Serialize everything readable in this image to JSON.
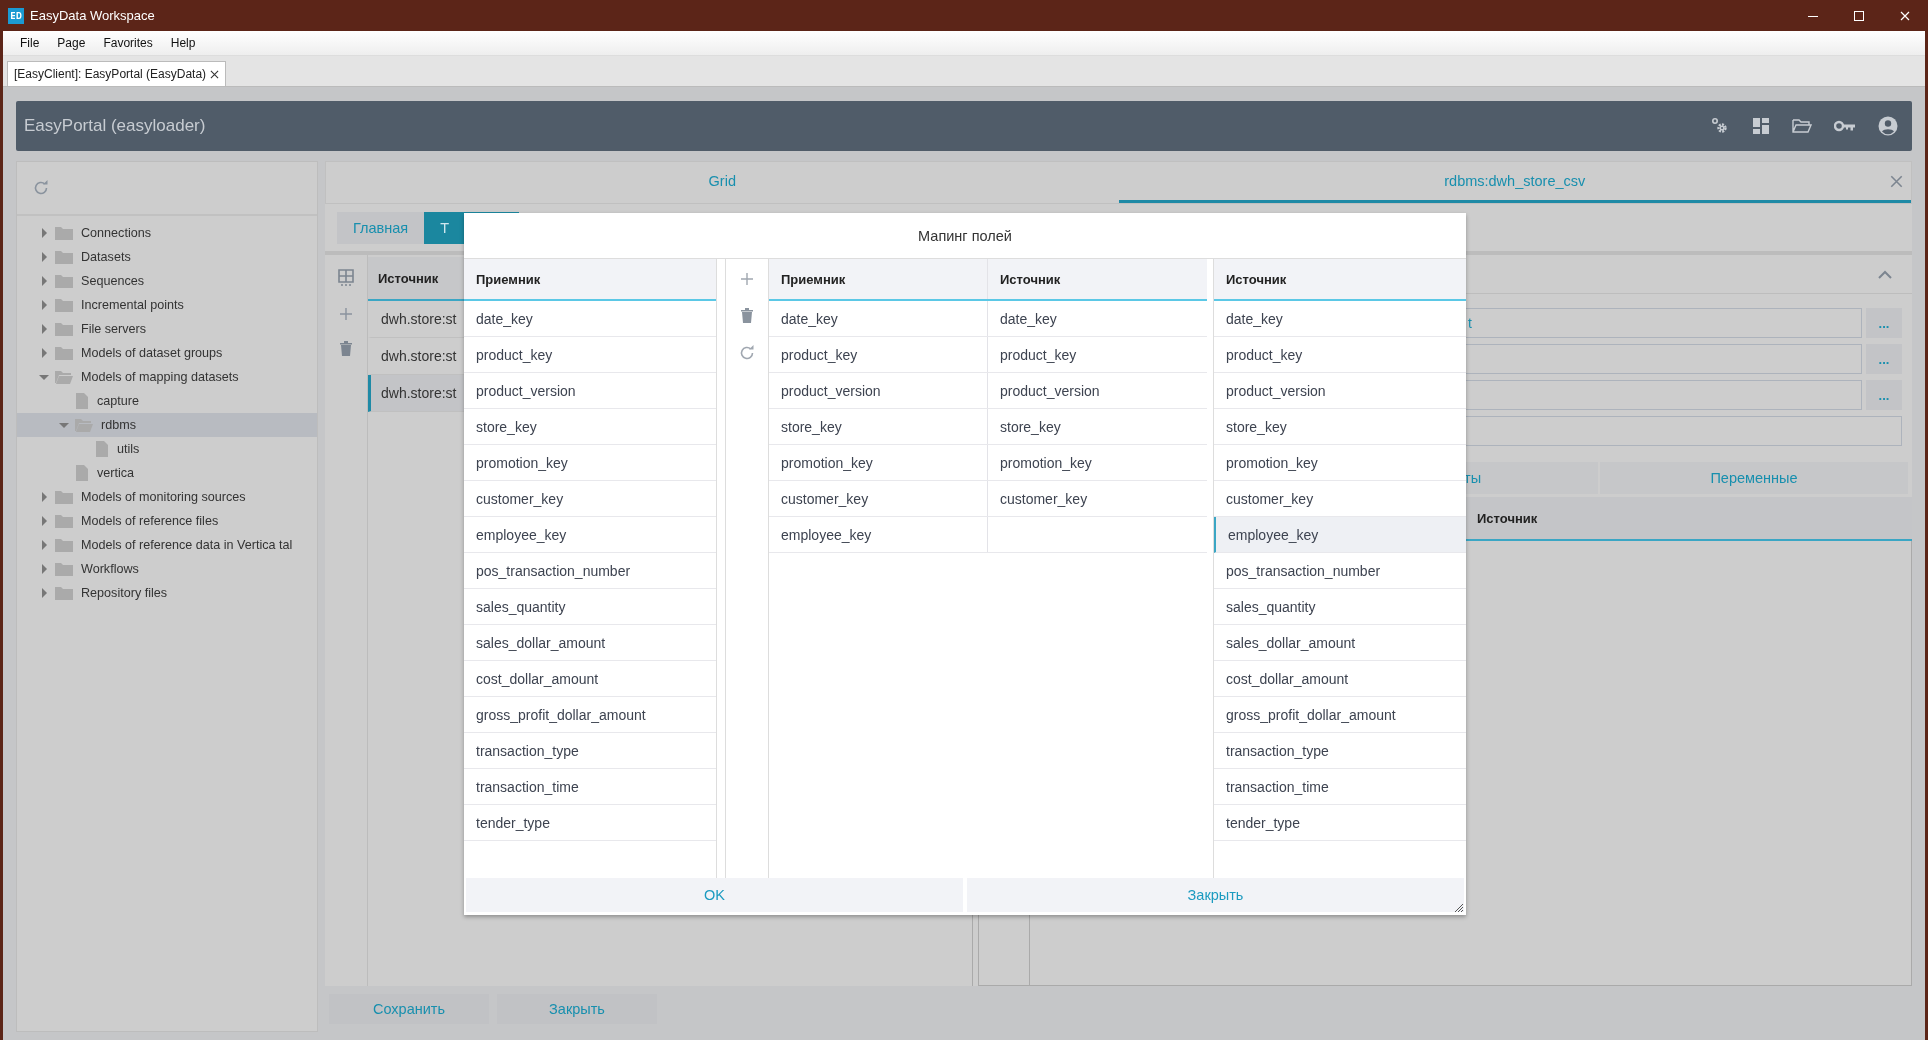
{
  "window": {
    "title": "EasyData Workspace"
  },
  "menu": [
    "File",
    "Page",
    "Favorites",
    "Help"
  ],
  "doc_tabs": [
    {
      "label": "[EasyClient]: EasyPortal (EasyData)",
      "selected": true
    }
  ],
  "header": {
    "title": "EasyPortal (easyloader)"
  },
  "tree": [
    {
      "label": "Connections",
      "kind": "folder",
      "expanded": false,
      "selected": false
    },
    {
      "label": "Datasets",
      "kind": "folder",
      "expanded": false,
      "selected": false
    },
    {
      "label": "Sequences",
      "kind": "folder",
      "expanded": false,
      "selected": false
    },
    {
      "label": "Incremental points",
      "kind": "folder",
      "expanded": false,
      "selected": false
    },
    {
      "label": "File servers",
      "kind": "folder",
      "expanded": false,
      "selected": false
    },
    {
      "label": "Models of dataset groups",
      "kind": "folder",
      "expanded": false,
      "selected": false
    },
    {
      "label": "Models of mapping datasets",
      "kind": "folder",
      "expanded": true,
      "selected": false,
      "children": [
        {
          "label": "capture",
          "kind": "file",
          "selected": false
        },
        {
          "label": "rdbms",
          "kind": "folder",
          "expanded": true,
          "selected": true,
          "children": [
            {
              "label": "utils",
              "kind": "file",
              "selected": false
            }
          ]
        },
        {
          "label": "vertica",
          "kind": "file",
          "selected": false
        }
      ]
    },
    {
      "label": "Models of monitoring sources",
      "kind": "folder",
      "expanded": false,
      "selected": false
    },
    {
      "label": "Models of reference files",
      "kind": "folder",
      "expanded": false,
      "selected": false
    },
    {
      "label": "Models of reference data in Vertica tal",
      "kind": "folder",
      "expanded": false,
      "selected": false
    },
    {
      "label": "Workflows",
      "kind": "folder",
      "expanded": false,
      "selected": false
    },
    {
      "label": "Repository files",
      "kind": "folder",
      "expanded": false,
      "selected": false
    }
  ],
  "content_tabs": [
    {
      "label": "Grid",
      "selected": false
    },
    {
      "label": "rdbms:dwh_store_csv",
      "selected": true
    }
  ],
  "sub_tabs": [
    {
      "label": "Главная",
      "selected": false
    },
    {
      "label": "Т",
      "selected": true
    }
  ],
  "source_list": {
    "header": "Источник",
    "rows": [
      {
        "label": "dwh.store:st",
        "selected": false
      },
      {
        "label": "dwh.store:st",
        "selected": false
      },
      {
        "label": "dwh.store:st",
        "selected": true
      }
    ]
  },
  "settings": {
    "fields": [
      {
        "kind": "browse",
        "value": "t",
        "button": "..."
      },
      {
        "kind": "browse",
        "button": "..."
      },
      {
        "kind": "browse",
        "button": "..."
      },
      {
        "kind": "text"
      }
    ],
    "tabs": [
      {
        "label": "ты",
        "selected": false
      },
      {
        "label": "Переменные",
        "selected": false
      }
    ],
    "table": {
      "columns": [
        "Источник"
      ]
    }
  },
  "buttons": [
    "Сохранить",
    "Закрыть"
  ],
  "dialog": {
    "title": "Мапинг полей",
    "target_list": {
      "header": "Приемник",
      "rows": [
        {
          "label": "date_key",
          "selected": false
        },
        {
          "label": "product_key",
          "selected": false
        },
        {
          "label": "product_version",
          "selected": false
        },
        {
          "label": "store_key",
          "selected": false
        },
        {
          "label": "promotion_key",
          "selected": false
        },
        {
          "label": "customer_key",
          "selected": false
        },
        {
          "label": "employee_key",
          "selected": false
        },
        {
          "label": "pos_transaction_number",
          "selected": false
        },
        {
          "label": "sales_quantity",
          "selected": false
        },
        {
          "label": "sales_dollar_amount",
          "selected": false
        },
        {
          "label": "cost_dollar_amount",
          "selected": false
        },
        {
          "label": "gross_profit_dollar_amount",
          "selected": false
        },
        {
          "label": "transaction_type",
          "selected": false
        },
        {
          "label": "transaction_time",
          "selected": false
        },
        {
          "label": "tender_type",
          "selected": false
        }
      ]
    },
    "mapping": {
      "columns": [
        "Приемник",
        "Источник"
      ],
      "rows": [
        {
          "cells": [
            "date_key",
            "date_key"
          ],
          "selected": false
        },
        {
          "cells": [
            "product_key",
            "product_key"
          ],
          "selected": false
        },
        {
          "cells": [
            "product_version",
            "product_version"
          ],
          "selected": false
        },
        {
          "cells": [
            "store_key",
            "store_key"
          ],
          "selected": false
        },
        {
          "cells": [
            "promotion_key",
            "promotion_key"
          ],
          "selected": false
        },
        {
          "cells": [
            "customer_key",
            "customer_key"
          ],
          "selected": false
        },
        {
          "cells": [
            "employee_key"
          ],
          "selected": false
        }
      ]
    },
    "source_list": {
      "header": "Источник",
      "rows": [
        {
          "label": "date_key",
          "selected": false
        },
        {
          "label": "product_key",
          "selected": false
        },
        {
          "label": "product_version",
          "selected": false
        },
        {
          "label": "store_key",
          "selected": false
        },
        {
          "label": "promotion_key",
          "selected": false
        },
        {
          "label": "customer_key",
          "selected": false
        },
        {
          "label": "employee_key",
          "selected": true
        },
        {
          "label": "pos_transaction_number",
          "selected": false
        },
        {
          "label": "sales_quantity",
          "selected": false
        },
        {
          "label": "sales_dollar_amount",
          "selected": false
        },
        {
          "label": "cost_dollar_amount",
          "selected": false
        },
        {
          "label": "gross_profit_dollar_amount",
          "selected": false
        },
        {
          "label": "transaction_type",
          "selected": false
        },
        {
          "label": "transaction_time",
          "selected": false
        },
        {
          "label": "tender_type",
          "selected": false
        }
      ]
    },
    "buttons": [
      "OK",
      "Закрыть"
    ]
  }
}
